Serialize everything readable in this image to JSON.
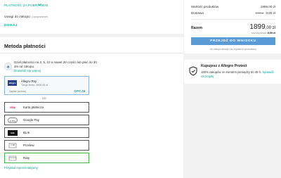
{
  "top": {
    "pay_on_delivery": "PŁATNOŚĆ ZA POBRANIEM",
    "note_label": "Uwagi do zakupu",
    "note_optional": "(opcjonalnie)",
    "add_label": "DODAJ"
  },
  "payment": {
    "title": "Metoda płatności",
    "promo_text": "Dziel płatności na 3, 5, 10 a nawet 20 części lub płać do 30 dni od zakupu.",
    "promo_link": "Dowiedz się więcej",
    "allegro_pay": {
      "logo": "allegro pay",
      "name": "Allegro Pay",
      "limit": "Twoje limity: 3600,00 zł",
      "sub": "Zapłać później",
      "options": "OPCJE"
    },
    "or_label": "lub",
    "options": [
      {
        "label": "Karta płatnicza",
        "icon": "card-icon",
        "icon_text": "VISA"
      },
      {
        "label": "Google Pay",
        "icon": "google-pay-icon",
        "icon_text": "G Pay"
      },
      {
        "label": "BLIK",
        "icon": "blik-icon",
        "icon_text": "blik"
      },
      {
        "label": "Przelew",
        "icon": "transfer-icon",
        "icon_text": ""
      },
      {
        "label": "Raty",
        "icon": "installments-icon",
        "icon_text": ""
      }
    ],
    "example_link": "Przykład reprezentatywny"
  },
  "summary": {
    "products_label": "Wartość produktów",
    "products_value": "1899,00 zł",
    "delivery_label": "Dostawa",
    "delivery_old": "8,99 zł",
    "delivery_value": "0,00 zł",
    "total_label": "Razem",
    "total_main": "1899",
    "total_dec": ",00 zł",
    "savings_label": "oszczędzasz",
    "savings_value": "8,99 zł",
    "buy_button": "PRZEJDŹ DO WNIOSKU",
    "terms": "Do zakupu stosuje się regulamin sprzedawcy"
  },
  "protect": {
    "title": "Kupujesz z Allegro Protect",
    "text": "100% zakupów ze zwrotem pieniędzy do 48 h.",
    "link": "Sprawdź szczegóły"
  },
  "colors": {
    "accent": "#00a790",
    "button": "#5a9bd5",
    "selected_border": "#45b54b",
    "background": "#f2f2f2"
  }
}
